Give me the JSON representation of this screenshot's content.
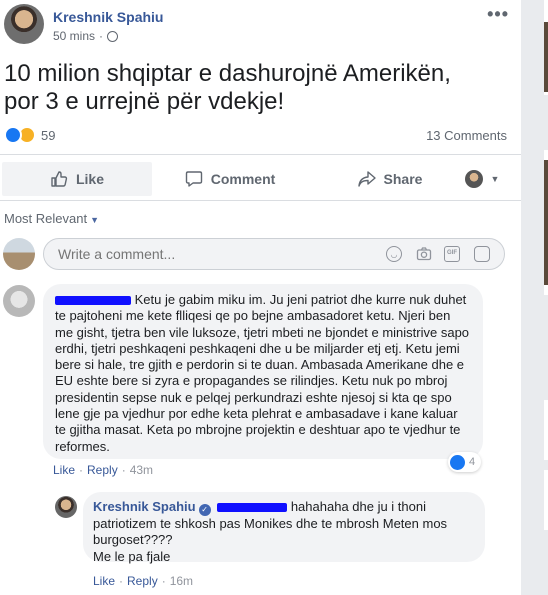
{
  "post": {
    "author": "Kreshnik Spahiu",
    "time": "50 mins",
    "more": "•••",
    "text_line1": "10 milion shqiptar e dashurojnë Amerikën,",
    "text_line2": "por 3 e urrejnë për vdekje!",
    "reaction_count": "59",
    "comments_count": "13 Comments"
  },
  "actions": {
    "like": "Like",
    "comment": "Comment",
    "share": "Share"
  },
  "comments_header": {
    "sort_label": "Most Relevant"
  },
  "composer": {
    "placeholder": "Write a comment..."
  },
  "comment1": {
    "text": "Ketu je gabim miku im. Ju jeni patriot dhe kurre nuk duhet te pajtoheni me kete flliqesi qe po bejne ambasadoret ketu. Njeri ben me gisht, tjetra ben vile luksoze, tjetri mbeti ne bjondet e ministrive sapo erdhi, tjetri peshkaqeni peshkaqeni dhe u be miljarder etj etj. Ketu jemi bere si hale, tre gjith e perdorin si te duan. Ambasada Amerikane dhe e EU eshte bere si zyra e propagandes se rilindjes. Ketu nuk po mbroj presidentin sepse nuk e pelqej perkundrazi eshte njesoj si kta qe spo lene gje pa vjedhur por edhe keta plehrat e ambasadave i kane kaluar te gjitha masat. Keta po mbrojne projektin e deshtuar apo te vjedhur te reformes.",
    "like_label": "Like",
    "reply_label": "Reply",
    "time": "43m",
    "reaction_count": "4"
  },
  "reply1": {
    "author": "Kreshnik Spahiu",
    "text": "hahahaha dhe ju i thoni patriotizem te shkosh pas Monikes dhe te mbrosh Meten mos burgoset????",
    "text2": "Me le pa fjale",
    "like_label": "Like",
    "reply_label": "Reply",
    "time": "16m"
  },
  "colors": {
    "link": "#385898",
    "redaction": "#1010ff",
    "bubble": "#f2f3f5"
  }
}
